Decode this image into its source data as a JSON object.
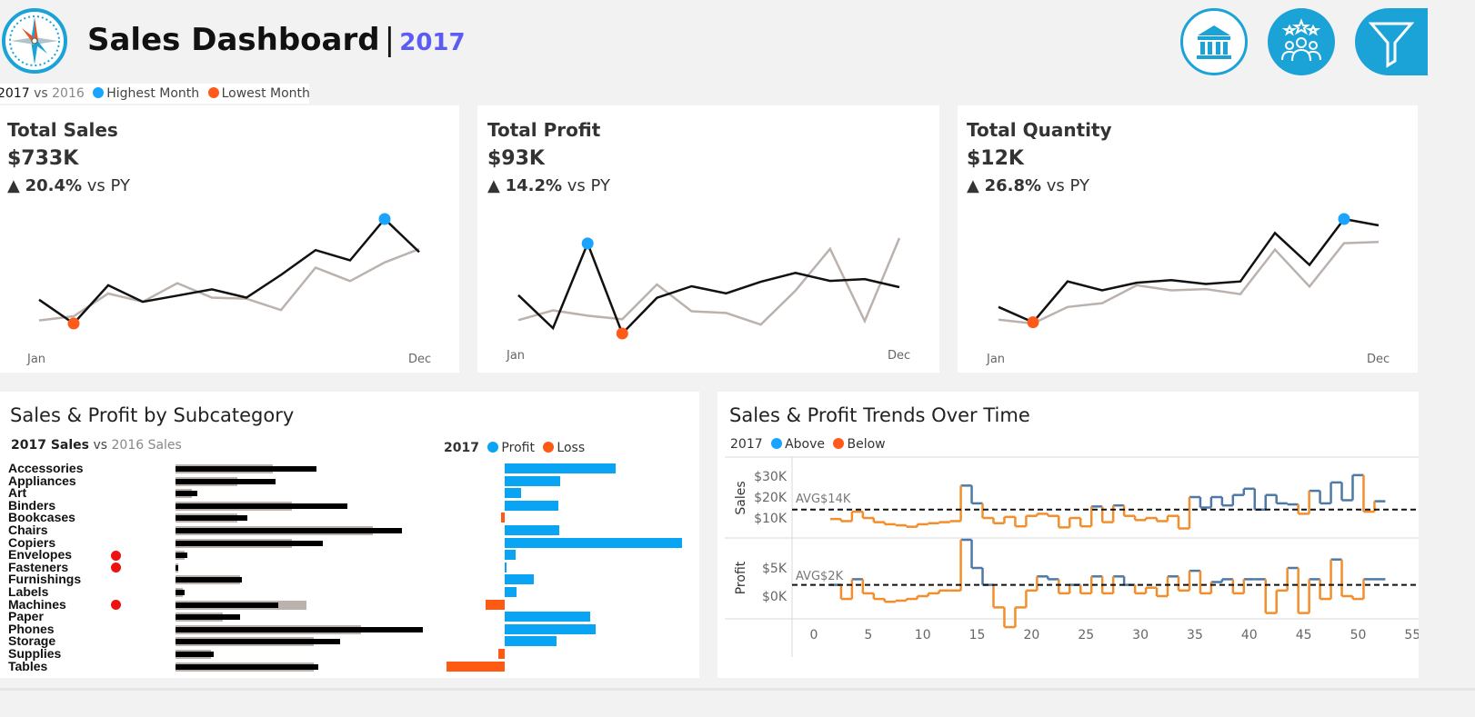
{
  "header": {
    "title": "Sales Dashboard",
    "separator": "|",
    "year": "2017",
    "year_color": "#5b5bf5",
    "logo_icon": "compass-icon",
    "nav_buttons": [
      {
        "icon": "bank-icon",
        "label": ""
      },
      {
        "icon": "customers-icon",
        "label": ""
      },
      {
        "icon": "filter-icon",
        "label": ""
      }
    ]
  },
  "legend_top": {
    "current": "2017",
    "vs": "vs",
    "previous": "2016",
    "highest": "Highest Month",
    "lowest": "Lowest Month"
  },
  "colors": {
    "highlight_high": "#1aa3ff",
    "highlight_low": "#ff5a1a",
    "current_line": "#111111",
    "previous_line": "#bbb2ad",
    "profit_bar": "#0aa4f5",
    "loss_bar": "#ff5a14",
    "above": "#4e79a7",
    "below": "#f28e2b",
    "icon_accent": "#1ba3d8"
  },
  "kpis": [
    {
      "label": "Total Sales",
      "value": "$733K",
      "arrow": "▲",
      "change": "20.4%",
      "change_suffix": "vs PY",
      "x_start": "Jan",
      "x_end": "Dec",
      "current": [
        3.2,
        0.9,
        4.6,
        3.0,
        3.6,
        4.2,
        3.4,
        5.6,
        8.0,
        7.0,
        11.0,
        7.8
      ],
      "previous": [
        1.2,
        1.6,
        3.8,
        3.0,
        4.8,
        3.4,
        3.3,
        2.2,
        6.3,
        5.0,
        6.8,
        8.1
      ],
      "high_index": 10,
      "low_index": 1
    },
    {
      "label": "Total Profit",
      "value": "$93K",
      "arrow": "▲",
      "change": "14.2%",
      "change_suffix": "vs PY",
      "x_start": "Jan",
      "x_end": "Dec",
      "current": [
        4.0,
        0.3,
        9.8,
        -0.3,
        3.7,
        5.0,
        4.2,
        5.5,
        6.5,
        5.6,
        5.8,
        4.9
      ],
      "previous": [
        1.2,
        2.3,
        1.7,
        1.3,
        5.2,
        2.2,
        2.0,
        0.7,
        4.5,
        9.2,
        1.1,
        10.4
      ],
      "high_index": 2,
      "low_index": 3
    },
    {
      "label": "Total Quantity",
      "value": "$12K",
      "arrow": "▲",
      "change": "26.8%",
      "change_suffix": "vs PY",
      "x_start": "Jan",
      "x_end": "Dec",
      "current": [
        2.9,
        1.7,
        4.9,
        4.2,
        4.8,
        5.0,
        4.7,
        4.9,
        8.7,
        6.2,
        9.8,
        9.3
      ],
      "previous": [
        1.9,
        1.6,
        2.9,
        3.2,
        4.6,
        4.2,
        4.3,
        3.9,
        7.4,
        4.5,
        7.9,
        8.0
      ],
      "high_index": 10,
      "low_index": 1
    }
  ],
  "subcategory": {
    "title": "Sales & Profit by Subcategory",
    "sales_legend_current": "2017 Sales",
    "sales_legend_vs": "vs",
    "sales_legend_previous": "2016 Sales",
    "profit_legend_year": "2017",
    "profit_legend_profit": "Profit",
    "profit_legend_loss": "Loss",
    "warning_color": "#ee1111",
    "rows": [
      {
        "name": "Accessories",
        "sales_2017": 59,
        "sales_2016": 41,
        "profit": 16.5,
        "flag": false
      },
      {
        "name": "Appliances",
        "sales_2017": 42,
        "sales_2016": 26,
        "profit": 8.3,
        "flag": false
      },
      {
        "name": "Art",
        "sales_2017": 9,
        "sales_2016": 7,
        "profit": 2.4,
        "flag": false
      },
      {
        "name": "Binders",
        "sales_2017": 72,
        "sales_2016": 49,
        "profit": 8.0,
        "flag": false
      },
      {
        "name": "Bookcases",
        "sales_2017": 30,
        "sales_2016": 26,
        "profit": -0.6,
        "flag": false
      },
      {
        "name": "Chairs",
        "sales_2017": 95,
        "sales_2016": 83,
        "profit": 8.2,
        "flag": false
      },
      {
        "name": "Copiers",
        "sales_2017": 62,
        "sales_2016": 49,
        "profit": 26.5,
        "flag": false
      },
      {
        "name": "Envelopes",
        "sales_2017": 5,
        "sales_2016": 4,
        "profit": 1.6,
        "flag": true
      },
      {
        "name": "Fasteners",
        "sales_2017": 1,
        "sales_2016": 1,
        "profit": 0.2,
        "flag": true
      },
      {
        "name": "Furnishings",
        "sales_2017": 28,
        "sales_2016": 27,
        "profit": 4.3,
        "flag": false
      },
      {
        "name": "Labels",
        "sales_2017": 4,
        "sales_2016": 3,
        "profit": 1.8,
        "flag": false
      },
      {
        "name": "Machines",
        "sales_2017": 43,
        "sales_2016": 55,
        "profit": -2.9,
        "flag": true
      },
      {
        "name": "Paper",
        "sales_2017": 27,
        "sales_2016": 20,
        "profit": 12.8,
        "flag": false
      },
      {
        "name": "Phones",
        "sales_2017": 104,
        "sales_2016": 78,
        "profit": 13.6,
        "flag": false
      },
      {
        "name": "Storage",
        "sales_2017": 69,
        "sales_2016": 58,
        "profit": 7.8,
        "flag": false
      },
      {
        "name": "Supplies",
        "sales_2017": 16,
        "sales_2016": 15,
        "profit": -0.9,
        "flag": false
      },
      {
        "name": "Tables",
        "sales_2017": 60,
        "sales_2016": 58,
        "profit": -8.7,
        "flag": false
      }
    ]
  },
  "trends": {
    "title": "Sales & Profit Trends Over Time",
    "legend_year": "2017",
    "legend_above": "Above",
    "legend_below": "Below",
    "sales_axis_label": "Sales",
    "profit_axis_label": "Profit",
    "sales_avg_label": "AVG$14K",
    "profit_avg_label": "AVG$2K",
    "sales_ticks": [
      "$30K",
      "$20K",
      "$10K"
    ],
    "profit_ticks": [
      "$5K",
      "$0K"
    ],
    "x_ticks": [
      "0",
      "5",
      "10",
      "15",
      "20",
      "25",
      "30",
      "35",
      "40",
      "45",
      "50",
      "55"
    ],
    "sales_avg": 14,
    "profit_avg": 2,
    "weeks": [
      2,
      3,
      4,
      5,
      6,
      7,
      8,
      9,
      10,
      11,
      12,
      13,
      14,
      15,
      16,
      17,
      18,
      19,
      20,
      21,
      22,
      23,
      24,
      25,
      26,
      27,
      28,
      29,
      30,
      31,
      32,
      33,
      34,
      35,
      36,
      37,
      38,
      39,
      40,
      41,
      42,
      43,
      44,
      45,
      46,
      47,
      48,
      49,
      50,
      51,
      52
    ],
    "sales": [
      9.5,
      8.5,
      13,
      10,
      8,
      7,
      6.5,
      5.8,
      7,
      7.5,
      8,
      8.5,
      25.5,
      17,
      10,
      7.5,
      10.5,
      6,
      11,
      12,
      11,
      5.5,
      10,
      6,
      15.5,
      8,
      16,
      11,
      9,
      10,
      8.5,
      11,
      5,
      20,
      15,
      20,
      16,
      21,
      24,
      14,
      21,
      17,
      16.5,
      12,
      23,
      17,
      27,
      18.5,
      30.5,
      13,
      18
    ],
    "profit": [
      2,
      -0.5,
      3,
      0.5,
      -0.5,
      -1,
      -0.8,
      -0.5,
      0,
      0.5,
      1,
      1,
      10,
      5,
      2,
      -2,
      -5.5,
      -2,
      1,
      3.5,
      3,
      0.5,
      2,
      0.5,
      3.5,
      0.5,
      3.5,
      2,
      0.5,
      1.5,
      0,
      3.5,
      1,
      4.5,
      0.5,
      2.5,
      3,
      0.5,
      3,
      3,
      -3,
      1,
      5,
      -3,
      3,
      -0.5,
      6.5,
      0,
      -0.5,
      3,
      3
    ]
  }
}
